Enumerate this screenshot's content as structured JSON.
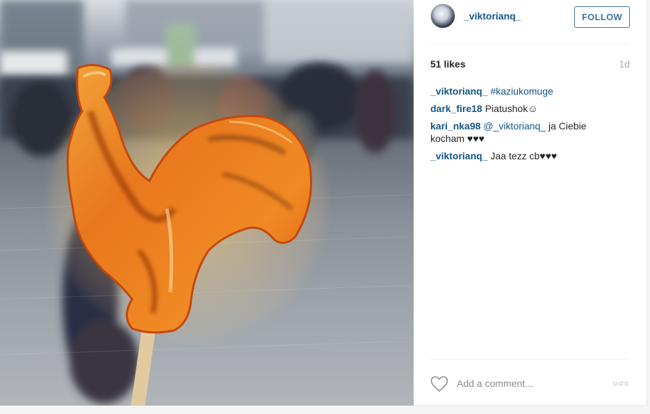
{
  "post": {
    "author": "_viktorianq_",
    "follow_label": "FOLLOW",
    "likes": "51 likes",
    "time_ago": "1d",
    "comments": [
      {
        "user": "_viktorianq_",
        "tag": "#kaziukomuge"
      },
      {
        "user": "dark_fire18",
        "text": "Piatushok☺"
      },
      {
        "user": "kari_nka98",
        "mention": "@_viktorianq_",
        "text": "ja Ciebie kocham ♥♥♥"
      },
      {
        "user": "_viktorianq_",
        "text": "Jaa tezz cb♥♥♥"
      }
    ],
    "add_comment_placeholder": "Add a comment...",
    "more_label": "○○○"
  },
  "icons": {
    "like": "heart-icon",
    "options": "more-options-icon"
  },
  "colors": {
    "link": "#125688",
    "follow": "#3f729b",
    "muted": "#a5a7aa"
  }
}
